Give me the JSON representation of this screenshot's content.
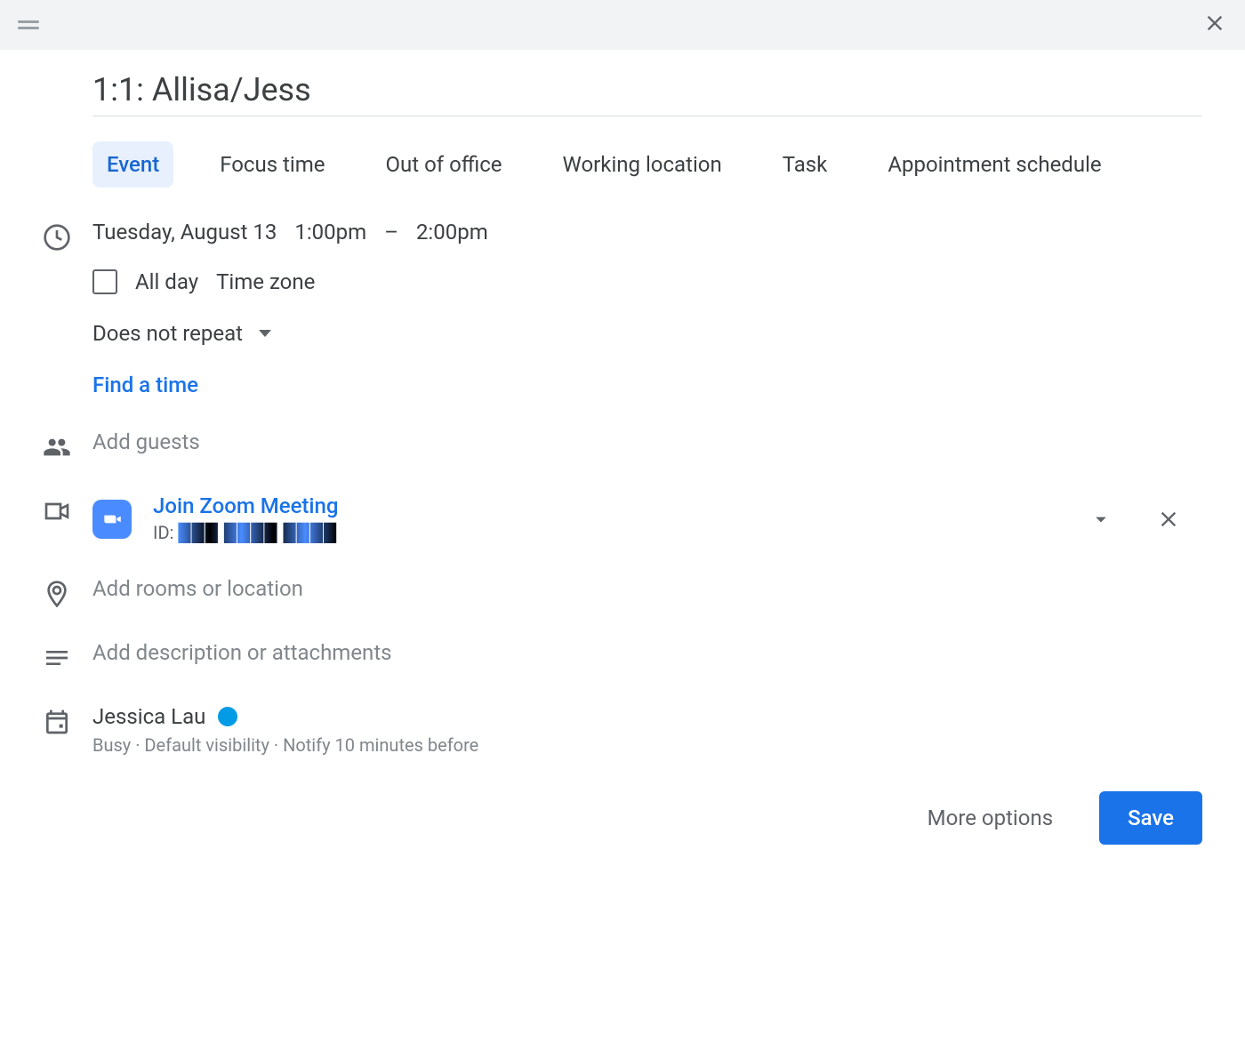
{
  "header": {},
  "title": "1:1: Allisa/Jess",
  "tabs": [
    {
      "label": "Event",
      "active": true
    },
    {
      "label": "Focus time"
    },
    {
      "label": "Out of office"
    },
    {
      "label": "Working location"
    },
    {
      "label": "Task"
    },
    {
      "label": "Appointment schedule"
    }
  ],
  "datetime": {
    "date": "Tuesday, August 13",
    "start": "1:00pm",
    "end": "2:00pm",
    "separator": "–"
  },
  "allday": {
    "label": "All day",
    "checked": false,
    "timezone_label": "Time zone"
  },
  "repeat": {
    "label": "Does not repeat"
  },
  "find_time_label": "Find a time",
  "guests_placeholder": "Add guests",
  "zoom": {
    "title": "Join Zoom Meeting",
    "id_prefix": "ID: ",
    "id_value": "███ ████ ████"
  },
  "location_placeholder": "Add rooms or location",
  "description_placeholder": "Add description or attachments",
  "organizer": {
    "name": "Jessica Lau",
    "status": "Busy · Default visibility · Notify 10 minutes before"
  },
  "footer": {
    "more_options": "More options",
    "save": "Save"
  }
}
